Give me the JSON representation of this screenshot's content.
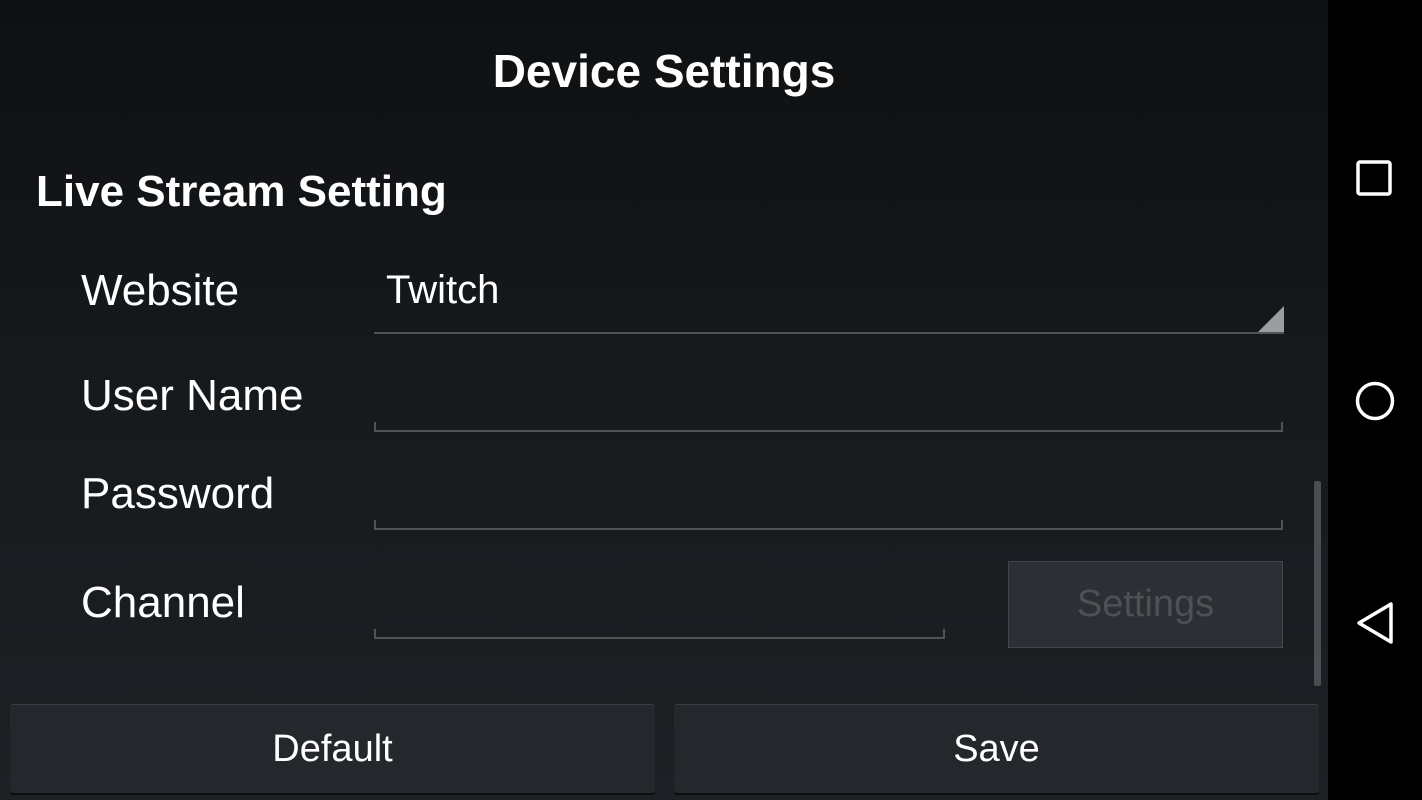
{
  "header": {
    "title": "Device Settings"
  },
  "section": {
    "heading": "Live Stream Setting"
  },
  "form": {
    "website": {
      "label": "Website",
      "value": "Twitch"
    },
    "user_name": {
      "label": "User Name",
      "value": ""
    },
    "password": {
      "label": "Password",
      "value": ""
    },
    "channel": {
      "label": "Channel",
      "value": "",
      "settings_button": "Settings"
    }
  },
  "actions": {
    "default_label": "Default",
    "save_label": "Save"
  },
  "nav_bar": {
    "icons": [
      "recents-square-icon",
      "home-circle-icon",
      "back-triangle-icon"
    ]
  },
  "colors": {
    "background": "#16191c",
    "text": "#ffffff",
    "disabled_text": "#4d5156",
    "underline": "#4f5358",
    "nav_bar": "#000000"
  }
}
